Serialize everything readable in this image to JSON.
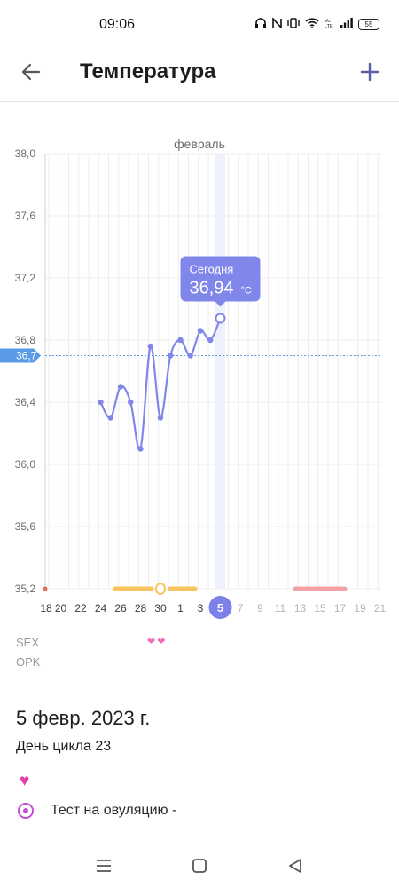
{
  "status_bar": {
    "time": "09:06",
    "battery": "55"
  },
  "app_bar": {
    "title": "Температура"
  },
  "chart_data": {
    "type": "line",
    "title": "февраль",
    "y_ticks": [
      "38,0",
      "37,6",
      "37,2",
      "36,8",
      "36,4",
      "36,0",
      "35,6",
      "35,2"
    ],
    "ylim": [
      35.2,
      38.0
    ],
    "x_tick_labels": [
      "18",
      "20",
      "22",
      "24",
      "26",
      "28",
      "30",
      "1",
      "3",
      "5",
      "7",
      "9",
      "11",
      "13",
      "15",
      "17",
      "19",
      "21"
    ],
    "selected_day": "5",
    "coverline_label": "36,7",
    "coverline_value": 36.7,
    "series": [
      {
        "x": [
          "24",
          "25",
          "26",
          "27",
          "28",
          "29",
          "30",
          "31",
          "1",
          "2",
          "3",
          "4",
          "5"
        ],
        "values": [
          36.4,
          36.3,
          36.5,
          36.4,
          36.1,
          36.76,
          36.3,
          36.7,
          36.8,
          36.7,
          36.86,
          36.8,
          36.94
        ]
      }
    ],
    "tooltip": {
      "label": "Сегодня",
      "value": "36,94",
      "unit": "°C"
    },
    "colors": {
      "line": "#8187ea",
      "fertile_bar": "#f9c35f",
      "period_bar": "#f3a3a3",
      "coverline": "#5a9be8",
      "selected": "#7b81e8"
    }
  },
  "rows": {
    "sex_label": "SEX",
    "opk_label": "OPK",
    "hearts": "❤❤"
  },
  "details": {
    "date": "5 февр. 2023 г.",
    "cycle_day": "День цикла 23",
    "ovulation_test": "Тест на овуляцию -"
  }
}
